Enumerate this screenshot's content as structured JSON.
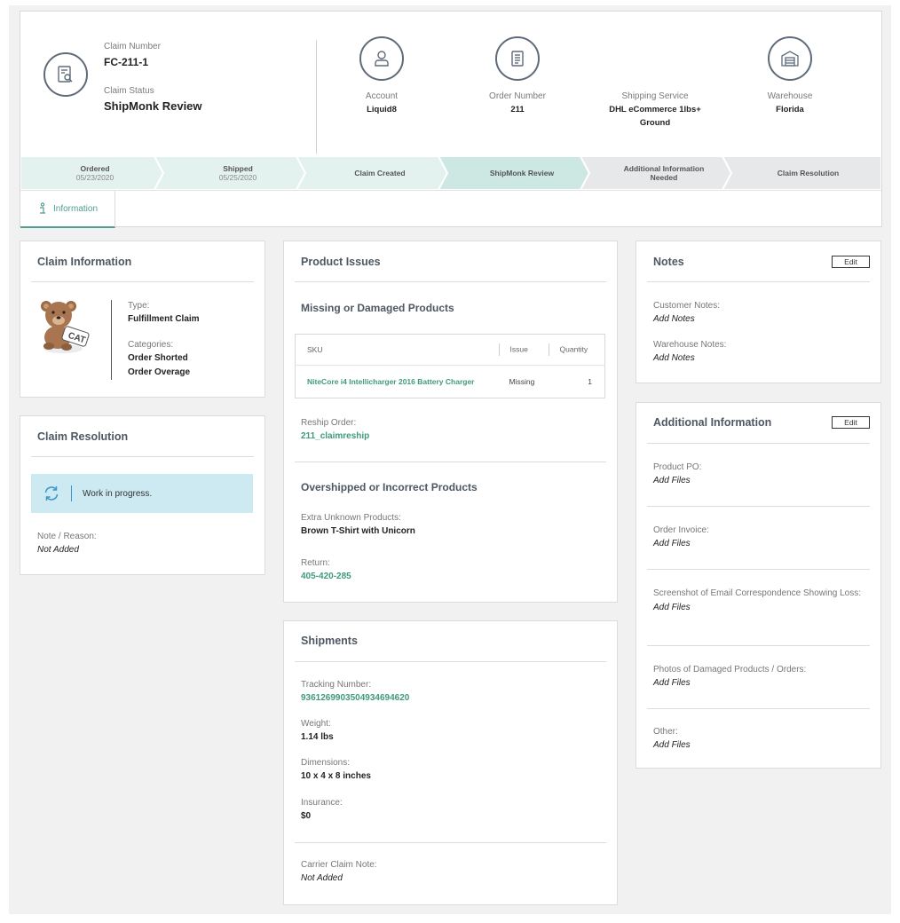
{
  "header": {
    "claim_number_label": "Claim Number",
    "claim_number": "FC-211-1",
    "claim_status_label": "Claim Status",
    "claim_status": "ShipMonk Review",
    "account_label": "Account",
    "account": "Liquid8",
    "order_number_label": "Order Number",
    "order_number": "211",
    "shipping_service_label": "Shipping Service",
    "shipping_service_line1": "DHL eCommerce 1lbs+",
    "shipping_service_line2": "Ground",
    "warehouse_label": "Warehouse",
    "warehouse": "Florida"
  },
  "progress": {
    "steps": [
      {
        "label": "Ordered",
        "date": "05/23/2020",
        "state": "done"
      },
      {
        "label": "Shipped",
        "date": "05/25/2020",
        "state": "done"
      },
      {
        "label": "Claim Created",
        "date": "",
        "state": "done"
      },
      {
        "label": "ShipMonk Review",
        "date": "",
        "state": "current"
      },
      {
        "label_line1": "Additional Information",
        "label_line2": "Needed",
        "state": "pending"
      },
      {
        "label": "Claim Resolution",
        "date": "",
        "state": "pending"
      }
    ],
    "colors": {
      "done": "#e4f2ef",
      "current": "#cde8e2",
      "pending": "#e7e8ea"
    }
  },
  "tabs": {
    "information": "Information"
  },
  "claim_info": {
    "title": "Claim Information",
    "type_label": "Type:",
    "type": "Fulfillment Claim",
    "categories_label": "Categories:",
    "categories": [
      "Order Shorted",
      "Order Overage"
    ],
    "mascot_tag": "CAT"
  },
  "claim_resolution": {
    "title": "Claim Resolution",
    "status": "Work in progress.",
    "note_label": "Note / Reason:",
    "note": "Not Added"
  },
  "product_issues": {
    "title": "Product Issues",
    "missing_title": "Missing or Damaged Products",
    "table_headers": {
      "sku": "SKU",
      "issue": "Issue",
      "quantity": "Quantity"
    },
    "rows": [
      {
        "sku": "NiteCore i4 Intellicharger 2016 Battery Charger",
        "issue": "Missing",
        "quantity": "1"
      }
    ],
    "reship_label": "Reship Order:",
    "reship": "211_claimreship",
    "overshipped_title": "Overshipped or Incorrect Products",
    "extra_label": "Extra Unknown Products:",
    "extra": "Brown T-Shirt with Unicorn",
    "return_label": "Return:",
    "return": "405-420-285"
  },
  "shipments": {
    "title": "Shipments",
    "tracking_label": "Tracking Number:",
    "tracking": "9361269903504934694620",
    "weight_label": "Weight:",
    "weight": "1.14 lbs",
    "dimensions_label": "Dimensions:",
    "dimensions": "10 x 4 x 8 inches",
    "insurance_label": "Insurance:",
    "insurance": "$0",
    "carrier_note_label": "Carrier Claim Note:",
    "carrier_note": "Not Added"
  },
  "notes": {
    "title": "Notes",
    "edit": "Edit",
    "customer_label": "Customer Notes:",
    "customer": "Add Notes",
    "warehouse_label": "Warehouse Notes:",
    "warehouse": "Add Notes"
  },
  "additional": {
    "title": "Additional Information",
    "edit": "Edit",
    "items": [
      {
        "label": "Product PO:",
        "value": "Add Files"
      },
      {
        "label": "Order Invoice:",
        "value": "Add Files"
      },
      {
        "label": "Screenshot of Email Correspondence Showing Loss:",
        "value": "Add Files"
      },
      {
        "label": "Photos of Damaged Products / Orders:",
        "value": "Add Files"
      },
      {
        "label": "Other:",
        "value": "Add Files"
      }
    ]
  },
  "colors": {
    "accent": "#3f9a7e",
    "icon_stroke": "#5f6b78",
    "wip_bg": "#cde9f2"
  }
}
